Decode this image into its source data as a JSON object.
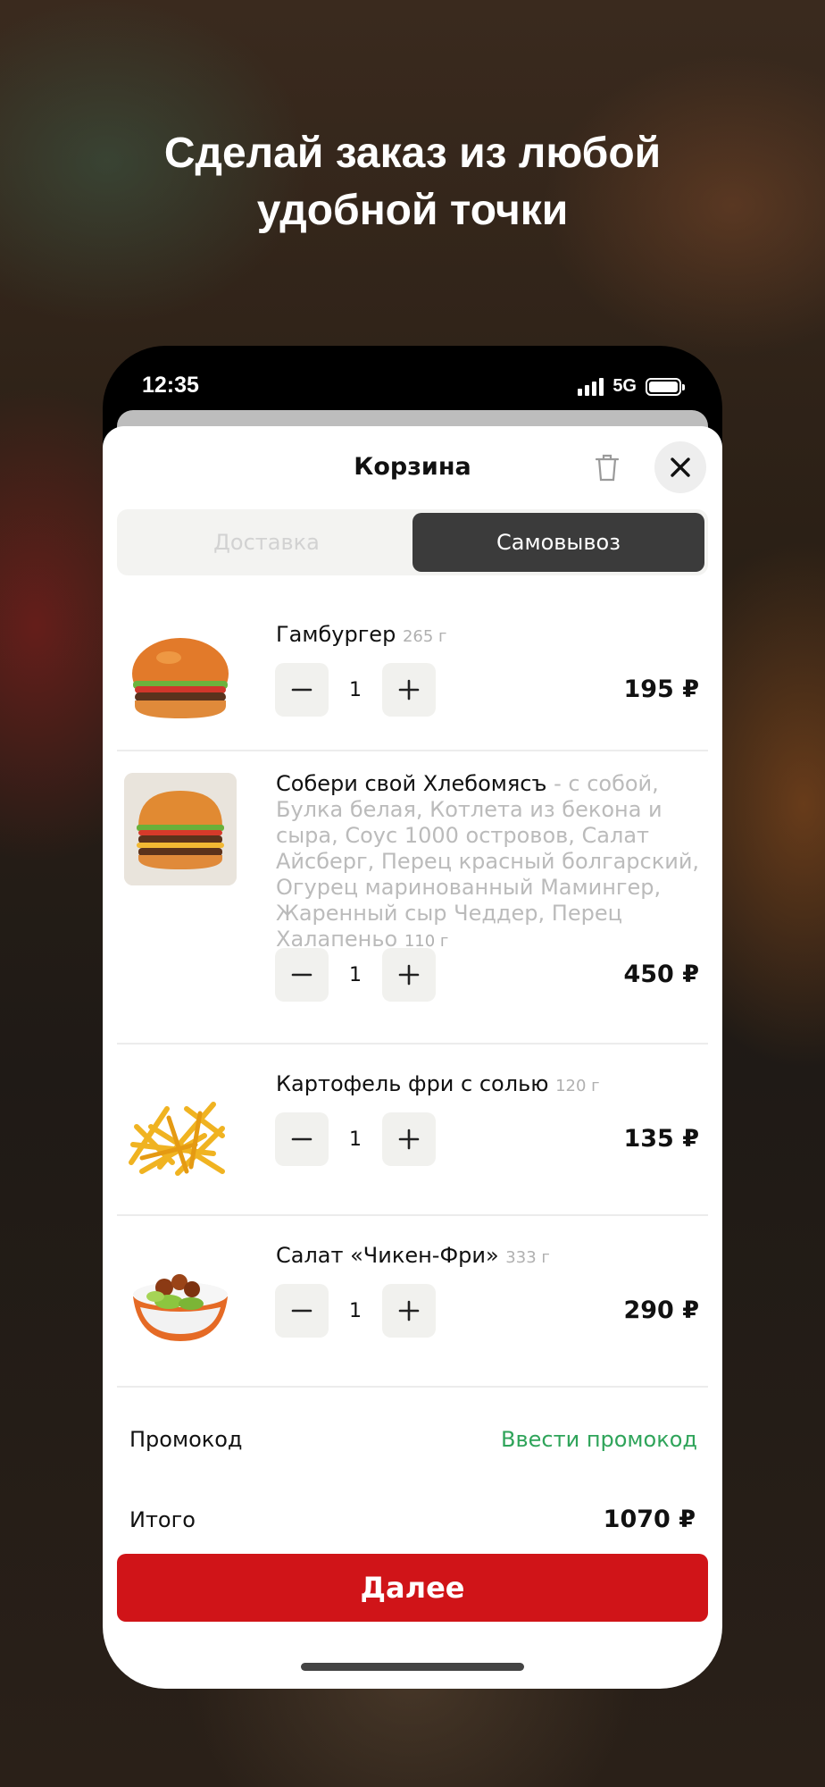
{
  "headline": "Сделай заказ из любой\nудобной точки",
  "status_bar": {
    "time": "12:35",
    "network": "5G"
  },
  "cart": {
    "title": "Корзина",
    "tabs": [
      {
        "label": "Доставка",
        "active": false
      },
      {
        "label": "Самовывоз",
        "active": true
      }
    ],
    "items": [
      {
        "name": "Гамбургер",
        "description": "",
        "weight": "265 г",
        "qty": "1",
        "price": "195 ₽"
      },
      {
        "name": "Собери свой Хлебомясъ",
        "description": " - с собой, Булка белая, Котлета из бекона и сыра, Соус 1000 островов, Салат Айсберг, Перец красный болгарский, Огурец маринованный Мамингер, Жаренный сыр Чеддер, Перец Халапеньо",
        "weight": "110 г",
        "qty": "1",
        "price": "450 ₽"
      },
      {
        "name": "Картофель фри с солью",
        "description": "",
        "weight": "120 г",
        "qty": "1",
        "price": "135 ₽"
      },
      {
        "name": "Салат «Чикен-Фри»",
        "description": "",
        "weight": "333 г",
        "qty": "1",
        "price": "290 ₽"
      }
    ],
    "promo_label": "Промокод",
    "promo_link": "Ввести промокод",
    "total_label": "Итого",
    "total_value": "1070 ₽",
    "next_button": "Далее"
  },
  "colors": {
    "accent": "#d01418",
    "link": "#2fa45a",
    "segment_active": "#3b3b3b"
  },
  "icons": [
    "trash-icon",
    "close-icon",
    "minus-icon",
    "plus-icon",
    "signal-icon",
    "battery-icon"
  ]
}
